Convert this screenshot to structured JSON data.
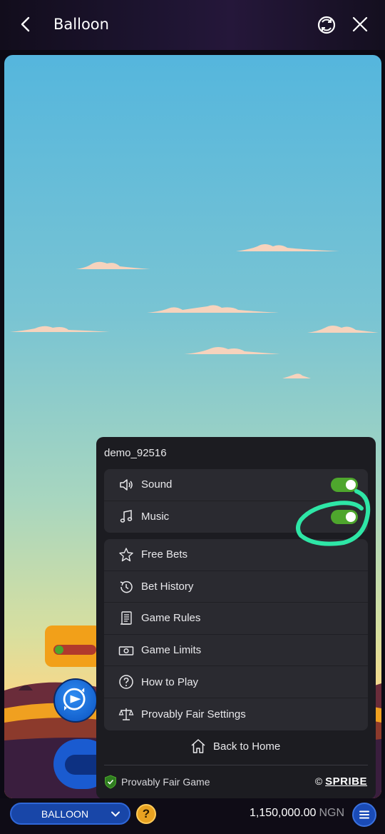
{
  "topbar": {
    "title": "Balloon",
    "back_icon": "chevron-left-icon",
    "refresh_icon": "refresh-icon",
    "close_icon": "close-icon"
  },
  "panel": {
    "username": "demo_92516",
    "toggles": [
      {
        "label": "Sound",
        "icon": "speaker-icon",
        "state": true
      },
      {
        "label": "Music",
        "icon": "music-note-icon",
        "state": true
      }
    ],
    "menu": [
      {
        "label": "Free Bets",
        "icon": "star-icon"
      },
      {
        "label": "Bet History",
        "icon": "history-icon"
      },
      {
        "label": "Game Rules",
        "icon": "document-icon"
      },
      {
        "label": "Game Limits",
        "icon": "banknote-icon"
      },
      {
        "label": "How to Play",
        "icon": "question-icon"
      },
      {
        "label": "Provably Fair Settings",
        "icon": "scales-icon"
      }
    ],
    "home": {
      "label": "Back to Home",
      "icon": "home-icon"
    },
    "footer": {
      "fair_label": "Provably Fair Game",
      "copyright": "©",
      "brand": "SPRIBE"
    }
  },
  "bottombar": {
    "game": "BALLOON",
    "help": "?",
    "balance": "1,150,000.00",
    "currency": "NGN"
  },
  "colors": {
    "accent_green": "#4ea62d",
    "panel_bg": "#1c1c21",
    "annotation": "#2ee6a6"
  }
}
